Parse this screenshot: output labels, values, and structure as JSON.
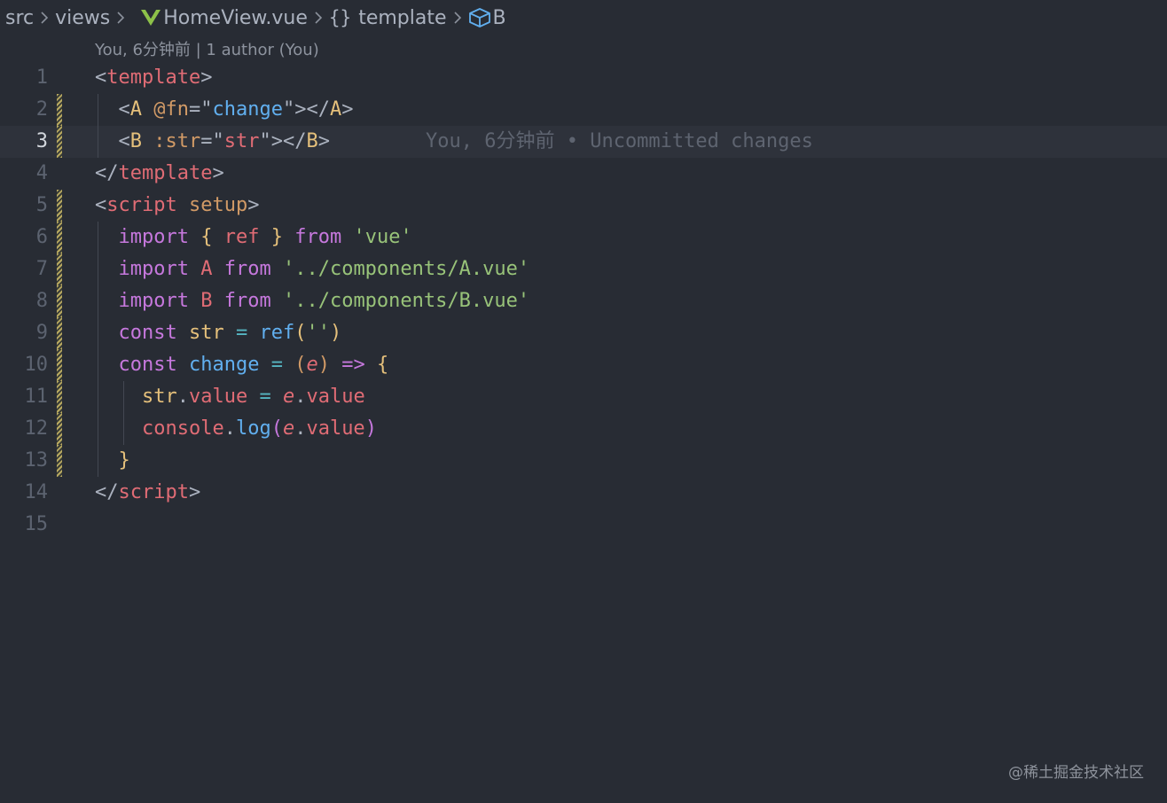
{
  "breadcrumb": {
    "src": "src",
    "views": "views",
    "file": "HomeView.vue",
    "braces": "{}",
    "template": "template",
    "symbol": "B"
  },
  "blame_header": "You, 6分钟前 | 1 author (You)",
  "inline_blame": "You, 6分钟前 • Uncommitted changes",
  "current_line": 3,
  "modified_lines": [
    2,
    3,
    5,
    6,
    7,
    8,
    9,
    10,
    11,
    12,
    13
  ],
  "lines": [
    {
      "n": "1",
      "tokens": [
        [
          "t-punct",
          "<"
        ],
        [
          "t-tag",
          "template"
        ],
        [
          "t-punct",
          ">"
        ]
      ]
    },
    {
      "n": "2",
      "tokens": [
        [
          "t-punct",
          "  <"
        ],
        [
          "t-comp",
          "A"
        ],
        [
          "t-punct",
          " "
        ],
        [
          "t-attr",
          "@fn"
        ],
        [
          "t-punct",
          "=\""
        ],
        [
          "t-val",
          "change"
        ],
        [
          "t-punct",
          "\"></"
        ],
        [
          "t-comp",
          "A"
        ],
        [
          "t-punct",
          ">"
        ]
      ]
    },
    {
      "n": "3",
      "tokens": [
        [
          "t-punct",
          "  <"
        ],
        [
          "t-comp",
          "B"
        ],
        [
          "t-punct",
          " "
        ],
        [
          "t-attr",
          ":str"
        ],
        [
          "t-punct",
          "=\""
        ],
        [
          "t-var",
          "str"
        ],
        [
          "t-punct",
          "\"></"
        ],
        [
          "t-comp",
          "B"
        ],
        [
          "t-punct",
          ">"
        ]
      ]
    },
    {
      "n": "4",
      "tokens": [
        [
          "t-punct",
          "</"
        ],
        [
          "t-tag",
          "template"
        ],
        [
          "t-punct",
          ">"
        ]
      ]
    },
    {
      "n": "5",
      "tokens": [
        [
          "t-punct",
          "<"
        ],
        [
          "t-tag",
          "script"
        ],
        [
          "t-punct",
          " "
        ],
        [
          "t-attr",
          "setup"
        ],
        [
          "t-punct",
          ">"
        ]
      ]
    },
    {
      "n": "6",
      "tokens": [
        [
          "t-punct",
          "  "
        ],
        [
          "t-kw",
          "import"
        ],
        [
          "t-punct",
          " "
        ],
        [
          "t-brace",
          "{"
        ],
        [
          "t-punct",
          " "
        ],
        [
          "t-var",
          "ref"
        ],
        [
          "t-punct",
          " "
        ],
        [
          "t-brace",
          "}"
        ],
        [
          "t-punct",
          " "
        ],
        [
          "t-kw",
          "from"
        ],
        [
          "t-punct",
          " "
        ],
        [
          "t-str",
          "'vue'"
        ]
      ]
    },
    {
      "n": "7",
      "tokens": [
        [
          "t-punct",
          "  "
        ],
        [
          "t-kw",
          "import"
        ],
        [
          "t-punct",
          " "
        ],
        [
          "t-var",
          "A"
        ],
        [
          "t-punct",
          " "
        ],
        [
          "t-kw",
          "from"
        ],
        [
          "t-punct",
          " "
        ],
        [
          "t-str",
          "'../components/A.vue'"
        ]
      ]
    },
    {
      "n": "8",
      "tokens": [
        [
          "t-punct",
          "  "
        ],
        [
          "t-kw",
          "import"
        ],
        [
          "t-punct",
          " "
        ],
        [
          "t-var",
          "B"
        ],
        [
          "t-punct",
          " "
        ],
        [
          "t-kw",
          "from"
        ],
        [
          "t-punct",
          " "
        ],
        [
          "t-str",
          "'../components/B.vue'"
        ]
      ]
    },
    {
      "n": "9",
      "tokens": [
        [
          "t-punct",
          "  "
        ],
        [
          "t-kw",
          "const"
        ],
        [
          "t-punct",
          " "
        ],
        [
          "t-ident",
          "str"
        ],
        [
          "t-punct",
          " "
        ],
        [
          "t-op",
          "="
        ],
        [
          "t-punct",
          " "
        ],
        [
          "t-fn",
          "ref"
        ],
        [
          "t-brace",
          "("
        ],
        [
          "t-str",
          "''"
        ],
        [
          "t-brace",
          ")"
        ]
      ]
    },
    {
      "n": "10",
      "tokens": [
        [
          "t-punct",
          "  "
        ],
        [
          "t-kw",
          "const"
        ],
        [
          "t-punct",
          " "
        ],
        [
          "t-fn",
          "change"
        ],
        [
          "t-punct",
          " "
        ],
        [
          "t-op",
          "="
        ],
        [
          "t-punct",
          " "
        ],
        [
          "t-paren",
          "("
        ],
        [
          "t-param",
          "e"
        ],
        [
          "t-paren",
          ")"
        ],
        [
          "t-punct",
          " "
        ],
        [
          "t-kw",
          "=>"
        ],
        [
          "t-punct",
          " "
        ],
        [
          "t-brace",
          "{"
        ]
      ]
    },
    {
      "n": "11",
      "tokens": [
        [
          "t-punct",
          "    "
        ],
        [
          "t-ident",
          "str"
        ],
        [
          "t-punct",
          "."
        ],
        [
          "t-var",
          "value"
        ],
        [
          "t-punct",
          " "
        ],
        [
          "t-op",
          "="
        ],
        [
          "t-punct",
          " "
        ],
        [
          "t-param",
          "e"
        ],
        [
          "t-punct",
          "."
        ],
        [
          "t-var",
          "value"
        ]
      ]
    },
    {
      "n": "12",
      "tokens": [
        [
          "t-punct",
          "    "
        ],
        [
          "t-var",
          "console"
        ],
        [
          "t-punct",
          "."
        ],
        [
          "t-fn",
          "log"
        ],
        [
          "t-kw",
          "("
        ],
        [
          "t-param",
          "e"
        ],
        [
          "t-punct",
          "."
        ],
        [
          "t-var",
          "value"
        ],
        [
          "t-kw",
          ")"
        ]
      ]
    },
    {
      "n": "13",
      "tokens": [
        [
          "t-punct",
          "  "
        ],
        [
          "t-brace",
          "}"
        ]
      ]
    },
    {
      "n": "14",
      "tokens": [
        [
          "t-punct",
          "</"
        ],
        [
          "t-tag",
          "script"
        ],
        [
          "t-punct",
          ">"
        ]
      ]
    },
    {
      "n": "15",
      "tokens": []
    }
  ],
  "watermark": "@稀土掘金技术社区",
  "colors": {
    "background": "#282c34",
    "vue_icon": "#8dc149",
    "symbol_icon": "#61afef"
  }
}
